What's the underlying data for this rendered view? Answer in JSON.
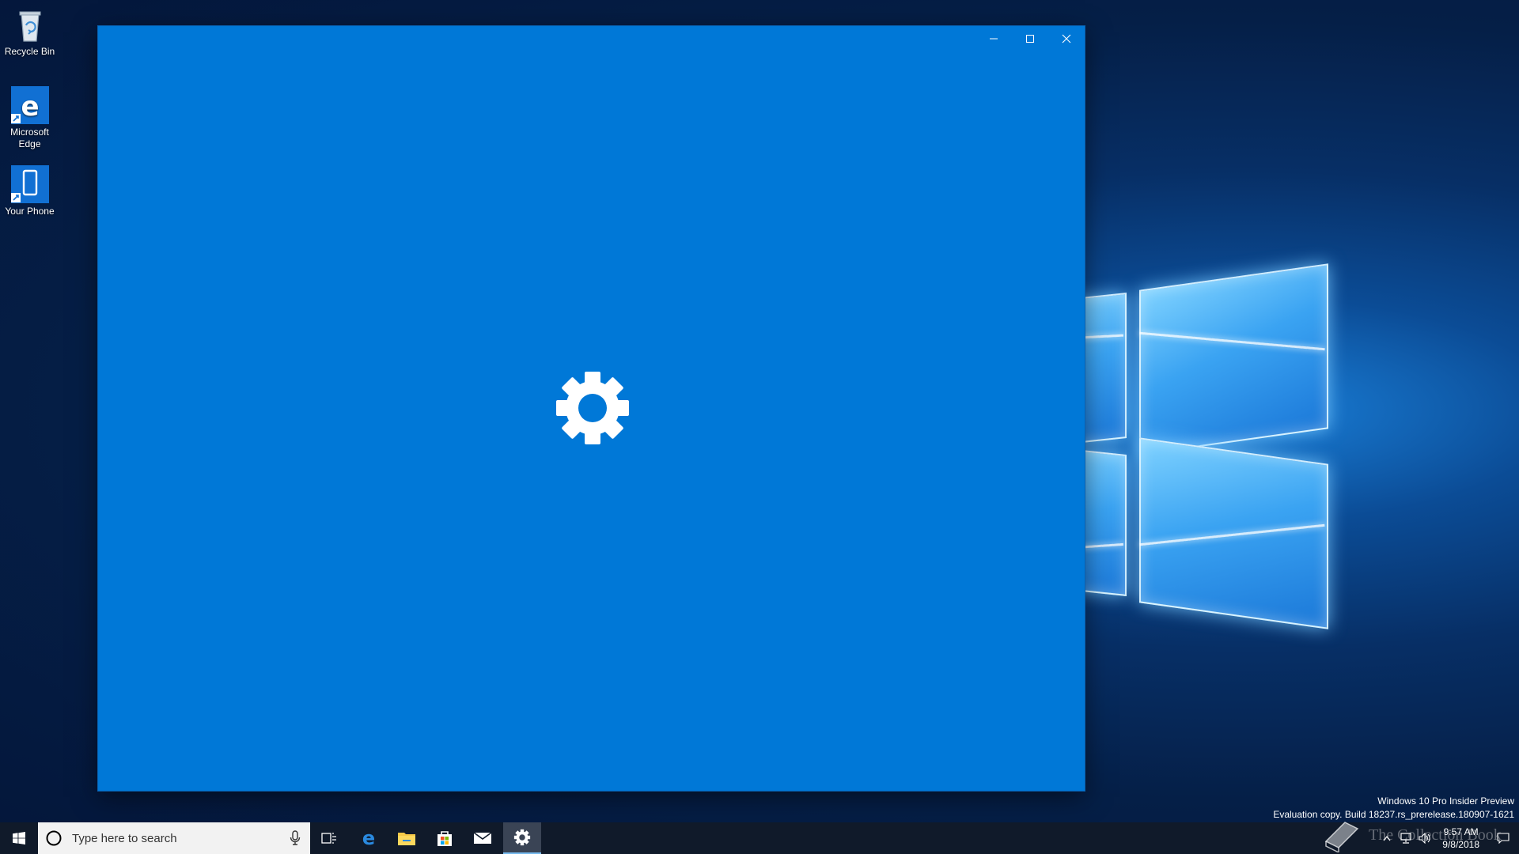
{
  "desktop": {
    "icons": [
      {
        "label": "Recycle Bin"
      },
      {
        "label": "Microsoft Edge"
      },
      {
        "label": "Your Phone"
      }
    ]
  },
  "window": {
    "app": "Settings",
    "background_color": "#0078d7",
    "splash_icon": "gear-icon",
    "caption_buttons": [
      "minimize",
      "maximize",
      "close"
    ]
  },
  "taskbar": {
    "search": {
      "placeholder": "Type here to search"
    },
    "pinned": [
      "task-view-icon",
      "edge-icon",
      "file-explorer-icon",
      "store-icon",
      "mail-icon",
      "settings-icon"
    ],
    "active_app": "settings"
  },
  "watermark": {
    "line1": "Windows 10 Pro Insider Preview",
    "line2": "Evaluation copy. Build 18237.rs_prerelease.180907-1621"
  },
  "clock": {
    "time": "9:57 AM",
    "date": "9/8/2018"
  },
  "overlay_logo": {
    "text": "The Collection Book"
  },
  "colors": {
    "accent": "#0078d7",
    "taskbar": "#101a2a"
  }
}
